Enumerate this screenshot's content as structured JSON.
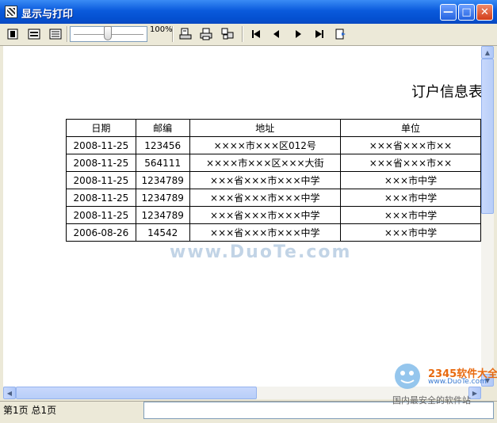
{
  "window": {
    "title": "显示与打印"
  },
  "toolbar": {
    "zoom_level": "100%"
  },
  "report": {
    "title": "订户信息表",
    "headers": [
      "日期",
      "邮编",
      "地址",
      "单位"
    ],
    "rows": [
      [
        "2008-11-25",
        "123456",
        "××××市×××区012号",
        "×××省×××市××"
      ],
      [
        "2008-11-25",
        "564111",
        "××××市×××区×××大街",
        "×××省×××市××"
      ],
      [
        "2008-11-25",
        "1234789",
        "×××省×××市×××中学",
        "×××市中学"
      ],
      [
        "2008-11-25",
        "1234789",
        "×××省×××市×××中学",
        "×××市中学"
      ],
      [
        "2008-11-25",
        "1234789",
        "×××省×××市×××中学",
        "×××市中学"
      ],
      [
        "2006-08-26",
        "14542",
        "×××省×××市×××中学",
        "×××市中学"
      ]
    ]
  },
  "status": {
    "pages": "第1页 总1页"
  },
  "watermark": {
    "text": "www.DuoTe.com"
  },
  "brand": {
    "name": "2345软件大全",
    "url": "www.DuoTe.com",
    "tagline": "国内最安全的软件站"
  }
}
